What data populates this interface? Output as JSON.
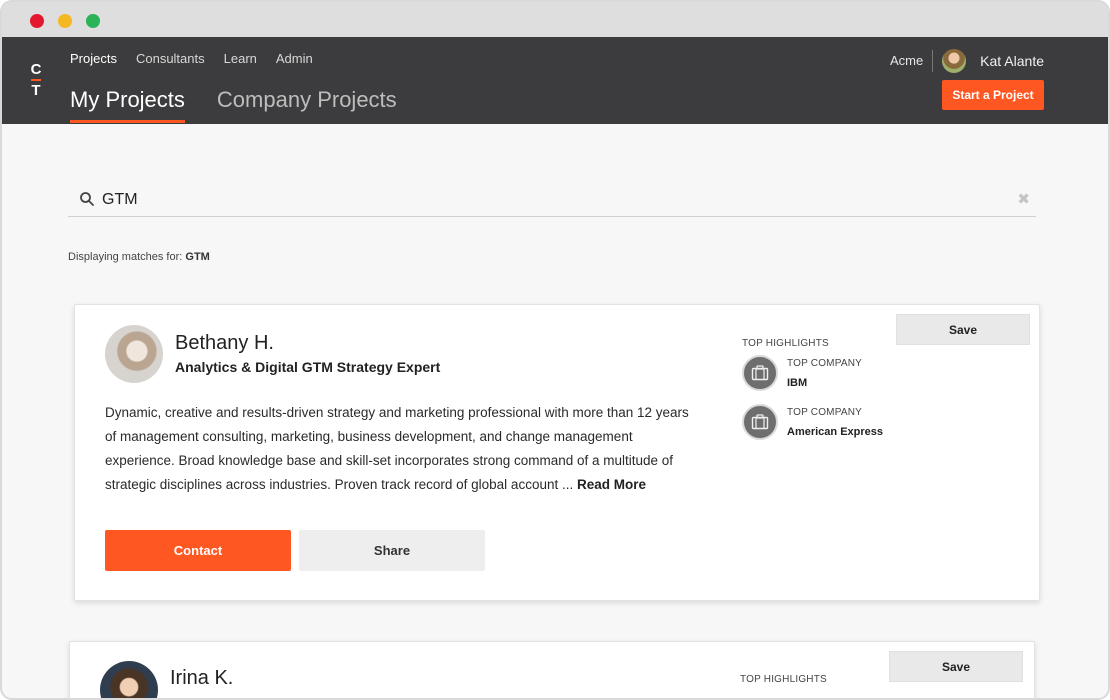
{
  "app": {
    "logo": {
      "top": "C",
      "bottom": "T"
    },
    "nav": [
      "Projects",
      "Consultants",
      "Learn",
      "Admin"
    ],
    "tabs": [
      "My Projects",
      "Company Projects"
    ],
    "org": "Acme",
    "user": "Kat Alante",
    "start_button": "Start a Project"
  },
  "search": {
    "value": "GTM",
    "matches_prefix": "Displaying matches for: ",
    "matches_term": "GTM"
  },
  "cards": [
    {
      "name": "Bethany H.",
      "title": "Analytics & Digital GTM Strategy Expert",
      "bio": "Dynamic, creative and results-driven strategy and marketing professional with more than 12 years of management consulting, marketing, business development, and change management experience. Broad knowledge base and skill-set incorporates strong command of a multitude of strategic disciplines across industries. Proven track record of global account ... ",
      "read_more": "Read More",
      "contact": "Contact",
      "share": "Share",
      "save": "Save",
      "highlights_title": "TOP HIGHLIGHTS",
      "highlights": [
        {
          "label": "TOP COMPANY",
          "value": "IBM",
          "icon": "briefcase-icon"
        },
        {
          "label": "TOP COMPANY",
          "value": "American Express",
          "icon": "briefcase-icon"
        }
      ]
    },
    {
      "name": "Irina K.",
      "save": "Save",
      "highlights_title": "TOP HIGHLIGHTS"
    }
  ],
  "colors": {
    "accent": "#ff5722",
    "header": "#3c3c3e",
    "background": "#f7f7f7"
  }
}
